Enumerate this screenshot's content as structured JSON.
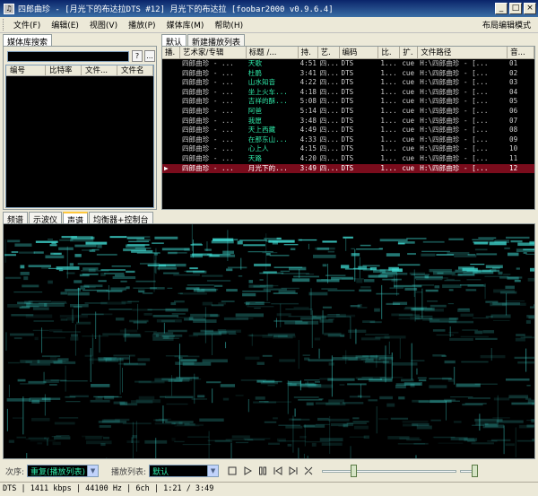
{
  "window": {
    "title": "四郎曲珍 - [月光下的布达拉DTS #12] 月光下的布达拉 [foobar2000 v0.9.6.4]",
    "minimize": "_",
    "maximize": "□",
    "close": "×"
  },
  "menu": {
    "items": [
      "文件(F)",
      "编辑(E)",
      "视图(V)",
      "播放(P)",
      "媒体库(M)",
      "帮助(H)"
    ],
    "layout_mode": "布局编辑模式"
  },
  "library": {
    "tab": "媒体库搜索",
    "help_btn": "?",
    "more_btn": "...",
    "columns": [
      "编号",
      "比特率",
      "文件...",
      "文件名"
    ]
  },
  "playlist": {
    "tabs": [
      "默认",
      "新建播放列表"
    ],
    "columns": [
      "播.",
      "艺术家/专辑",
      "标题 /...",
      "持.",
      "艺.",
      "编码",
      "比.",
      "扩.",
      "文件路径",
      "音..."
    ],
    "rows": [
      {
        "playing": "",
        "artist": "四郎曲珍 - ...",
        "title": "天歌",
        "length": "4:51",
        "art": "四...",
        "codec": "DTS",
        "bitrate": "1...",
        "ext": "cue",
        "path": "H:\\四郎曲珍 - [...",
        "track": "01"
      },
      {
        "playing": "",
        "artist": "四郎曲珍 - ...",
        "title": "杜鹃",
        "length": "3:41",
        "art": "四...",
        "codec": "DTS",
        "bitrate": "1...",
        "ext": "cue",
        "path": "H:\\四郎曲珍 - [...",
        "track": "02"
      },
      {
        "playing": "",
        "artist": "四郎曲珍 - ...",
        "title": "山水知音",
        "length": "4:22",
        "art": "四...",
        "codec": "DTS",
        "bitrate": "1...",
        "ext": "cue",
        "path": "H:\\四郎曲珍 - [...",
        "track": "03"
      },
      {
        "playing": "",
        "artist": "四郎曲珍 - ...",
        "title": "坐上火车...",
        "length": "4:18",
        "art": "四...",
        "codec": "DTS",
        "bitrate": "1...",
        "ext": "cue",
        "path": "H:\\四郎曲珍 - [...",
        "track": "04"
      },
      {
        "playing": "",
        "artist": "四郎曲珍 - ...",
        "title": "吉祥的酥...",
        "length": "5:08",
        "art": "四...",
        "codec": "DTS",
        "bitrate": "1...",
        "ext": "cue",
        "path": "H:\\四郎曲珍 - [...",
        "track": "05"
      },
      {
        "playing": "",
        "artist": "四郎曲珍 - ...",
        "title": "阿爸",
        "length": "5:14",
        "art": "四...",
        "codec": "DTS",
        "bitrate": "1...",
        "ext": "cue",
        "path": "H:\\四郎曲珍 - [...",
        "track": "06"
      },
      {
        "playing": "",
        "artist": "四郎曲珍 - ...",
        "title": "我愿",
        "length": "3:48",
        "art": "四...",
        "codec": "DTS",
        "bitrate": "1...",
        "ext": "cue",
        "path": "H:\\四郎曲珍 - [...",
        "track": "07"
      },
      {
        "playing": "",
        "artist": "四郎曲珍 - ...",
        "title": "天上西藏",
        "length": "4:49",
        "art": "四...",
        "codec": "DTS",
        "bitrate": "1...",
        "ext": "cue",
        "path": "H:\\四郎曲珍 - [...",
        "track": "08"
      },
      {
        "playing": "",
        "artist": "四郎曲珍 - ...",
        "title": "在那东山...",
        "length": "4:33",
        "art": "四...",
        "codec": "DTS",
        "bitrate": "1...",
        "ext": "cue",
        "path": "H:\\四郎曲珍 - [...",
        "track": "09"
      },
      {
        "playing": "",
        "artist": "四郎曲珍 - ...",
        "title": "心上人",
        "length": "4:15",
        "art": "四...",
        "codec": "DTS",
        "bitrate": "1...",
        "ext": "cue",
        "path": "H:\\四郎曲珍 - [...",
        "track": "10"
      },
      {
        "playing": "",
        "artist": "四郎曲珍 - ...",
        "title": "天路",
        "length": "4:20",
        "art": "四...",
        "codec": "DTS",
        "bitrate": "1...",
        "ext": "cue",
        "path": "H:\\四郎曲珍 - [...",
        "track": "11"
      },
      {
        "playing": "▶",
        "artist": "四郎曲珍 - ...",
        "title": "月光下的...",
        "length": "3:49",
        "art": "四...",
        "codec": "DTS",
        "bitrate": "1...",
        "ext": "cue",
        "path": "H:\\四郎曲珍 - [...",
        "track": "12"
      }
    ]
  },
  "vis_tabs": [
    "频谱",
    "示波仪",
    "声谱",
    "均衡器+控制台"
  ],
  "vis_active": 2,
  "toolbar": {
    "order_label": "次序:",
    "order_value": "重复(播放列表)",
    "playlist_label": "播放列表:",
    "playlist_value": "默认",
    "seek_position": 0.22,
    "volume_position": 0.96
  },
  "status": {
    "text": "DTS | 1411 kbps | 44100 Hz | 6ch | 1:21 / 3:49"
  },
  "colors": {
    "accent_text": "#2ee8a8",
    "selection": "#7a0c1c",
    "spectrogram": "#3fd8d0"
  }
}
